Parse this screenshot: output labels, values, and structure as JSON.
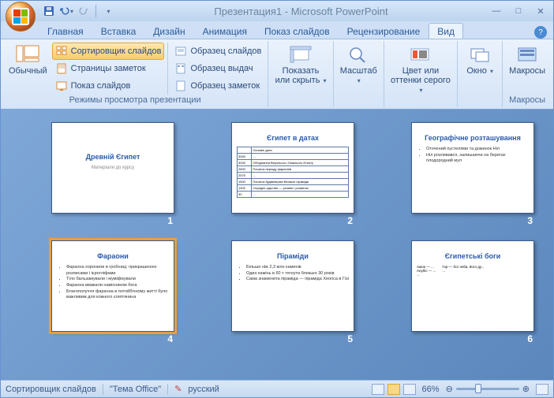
{
  "title": "Презентация1 - Microsoft PowerPoint",
  "tabs": [
    "Главная",
    "Вставка",
    "Дизайн",
    "Анимация",
    "Показ слайдов",
    "Рецензирование",
    "Вид"
  ],
  "active_tab": 6,
  "ribbon": {
    "g1": {
      "normal": "Обычный",
      "sorter": "Сортировщик слайдов",
      "notes": "Страницы заметок",
      "show": "Показ слайдов",
      "label": "Режимы просмотра презентации",
      "master_slides": "Образец слайдов",
      "master_handout": "Образец выдач",
      "master_notes": "Образец заметок"
    },
    "g2": {
      "show_hide": "Показать или скрыть",
      "drop": "▾"
    },
    "g3": {
      "zoom": "Масштаб",
      "drop": "▾"
    },
    "g4": {
      "color": "Цвет или оттенки серого",
      "drop": "▾"
    },
    "g5": {
      "window": "Окно",
      "drop": "▾"
    },
    "g6": {
      "macros": "Макросы",
      "label": "Макросы"
    }
  },
  "slides": [
    {
      "n": "1",
      "title": "Древній Єгипет",
      "sub": "Матеріали до курсу",
      "type": "title"
    },
    {
      "n": "2",
      "title": "Єгипет в датах",
      "type": "table",
      "rows": [
        [
          "",
          "Основні дати"
        ],
        [
          "3000",
          "..."
        ],
        [
          "3000",
          "Об'єднання Верхнього і Нижнього Єгипту"
        ],
        [
          "2600",
          "Початок періоду фараонів"
        ],
        [
          "2575",
          "..."
        ],
        [
          "1500",
          "Початок будівництва Великої піраміди"
        ],
        [
          "1400",
          "Середнє царство — розквіт і розвиток"
        ],
        [
          "30",
          "..."
        ]
      ]
    },
    {
      "n": "3",
      "title": "Географічне розташування",
      "type": "bullets",
      "items": [
        "Оточений пустелями та дожинок Ніл",
        "Ніл розливався, залишаючи на берегах плодородний мул"
      ]
    },
    {
      "n": "4",
      "title": "Фараони",
      "type": "bullets",
      "sel": true,
      "items": [
        "Фараона хоронили в гробниці, прикрашеною розписами і ієрогліфами",
        "Тіло бальзамували і муміфікували",
        "Фараона вважали намісником бога",
        "Благополуччя фараона в потойбічному житті було важливим для кожного єгиптянина"
      ]
    },
    {
      "n": "5",
      "title": "Піраміди",
      "type": "bullets",
      "items": [
        "Більше ніж 2,3 млн каменів",
        "Один камінь в 60 т тягнути близько 30 років",
        "Сама знаменита піраміда — піраміда Хеопса в Гізі"
      ]
    },
    {
      "n": "6",
      "title": "Єгипетські боги",
      "type": "cols",
      "cols": [
        [
          "Амон — ...",
          "Анубіс — ...",
          "..."
        ],
        [
          "Гор — бог неба, його ду...",
          "..."
        ]
      ]
    }
  ],
  "status": {
    "mode": "Сортировщик слайдов",
    "theme": "\"Тема Office\"",
    "lang": "русский",
    "zoom": "66%"
  }
}
